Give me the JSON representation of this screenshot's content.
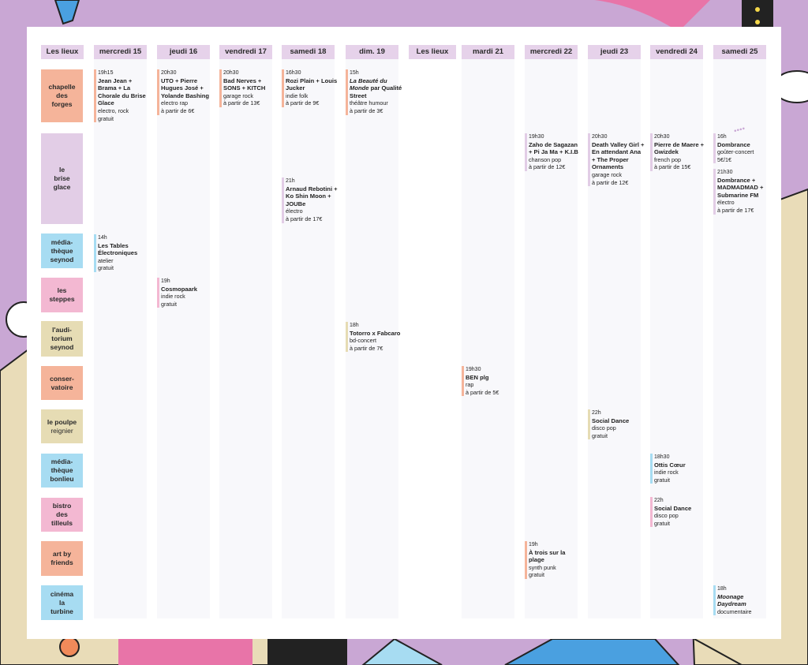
{
  "colors": {
    "salmon": "#f5b49a",
    "lilac": "#e2cde6",
    "blue": "#a7dcf2",
    "pink": "#f3b8d2",
    "khaki": "#e6dcb4",
    "header": "#e6d2ea"
  },
  "headers": [
    "Les lieux",
    "mercredi 15",
    "jeudi 16",
    "vendredi 17",
    "samedi 18",
    "dim. 19",
    "Les lieux",
    "mardi 21",
    "mercredi 22",
    "jeudi 23",
    "vendredi 24",
    "samedi 25"
  ],
  "venues": [
    {
      "lines": [
        "chapelle",
        "des",
        "forges"
      ],
      "color": "salmon"
    },
    {
      "lines": [
        "le",
        "brise",
        "glace"
      ],
      "color": "lilac"
    },
    {
      "lines": [
        "média-",
        "thèque",
        "seynod"
      ],
      "color": "blue"
    },
    {
      "lines": [
        "les",
        "steppes"
      ],
      "color": "pink"
    },
    {
      "lines": [
        "l'audi-",
        "torium",
        "seynod"
      ],
      "color": "khaki"
    },
    {
      "lines": [
        "conser-",
        "vatoire"
      ],
      "color": "salmon"
    },
    {
      "lines": [
        "le poulpe",
        "reignier"
      ],
      "color": "khaki"
    },
    {
      "lines": [
        "média-",
        "thèque",
        "bonlieu"
      ],
      "color": "blue"
    },
    {
      "lines": [
        "bistro",
        "des",
        "tilleuls"
      ],
      "color": "pink"
    },
    {
      "lines": [
        "art by",
        "friends"
      ],
      "color": "salmon"
    },
    {
      "lines": [
        "cinéma",
        "la",
        "turbine"
      ],
      "color": "blue"
    }
  ],
  "events": [
    {
      "time": "19h15",
      "title": "Jean Jean + Brama + La Chorale du Brise Glace",
      "genre": [
        "electro, rock",
        "gratuit"
      ],
      "color": "salmon"
    },
    {
      "time": "20h30",
      "title": "UTO + Pierre Hugues José + Yolande Bashing",
      "genre": [
        "electro rap",
        "à partir de 6€"
      ],
      "color": "salmon"
    },
    {
      "time": "20h30",
      "title": "Bad Nerves + SONS + KITCH",
      "genre": [
        "garage rock",
        "à partir de 13€"
      ],
      "color": "salmon"
    },
    {
      "time": "16h30",
      "title": "Rozi Plain + Louis Jucker",
      "genre": [
        "indie folk",
        "à partir de 9€"
      ],
      "color": "salmon"
    },
    {
      "time": "15h",
      "title_em": "La Beauté du Monde",
      "title": " par Qualité Street",
      "genre": [
        "théâtre humour",
        "à partir de 3€"
      ],
      "color": "salmon"
    },
    {
      "time": "19h30",
      "title": "Zaho de Sagazan + Pi Ja Ma + K.I.B",
      "genre": [
        "chanson pop",
        "à partir de 12€"
      ],
      "color": "lilac"
    },
    {
      "time": "20h30",
      "title": "Death Valley Girl + En attendant Ana + The Proper Ornaments",
      "genre": [
        "garage rock",
        "à partir de 12€"
      ],
      "color": "lilac"
    },
    {
      "time": "20h30",
      "title": "Pierre de Maere + Gwizdek",
      "genre": [
        "french pop",
        "à partir de 15€"
      ],
      "color": "lilac"
    },
    {
      "time": "16h",
      "title": "Dombrance",
      "genre": [
        "goûter-concert",
        "5€/1€"
      ],
      "color": "lilac"
    },
    {
      "time": "21h30",
      "title": "Dombrance + MADMADMAD + Submarine FM",
      "genre": [
        "électro",
        "à partir de 17€"
      ],
      "color": "lilac"
    },
    {
      "time": "21h",
      "title": "Arnaud Rebotini + Ko Shin Moon + JOUBe",
      "genre": [
        "électro",
        "à partir de 17€"
      ],
      "color": "lilac"
    },
    {
      "time": "14h",
      "title": "Les Tables Électroniques",
      "genre": [
        "atelier",
        "gratuit"
      ],
      "color": "blue"
    },
    {
      "time": "19h",
      "title": "Cosmopaark",
      "genre": [
        "indie rock",
        "gratuit"
      ],
      "color": "pink"
    },
    {
      "time": "18h",
      "title": "Totorro x Fabcaro",
      "genre": [
        "bd-concert",
        "à partir de 7€"
      ],
      "color": "khaki"
    },
    {
      "time": "19h30",
      "title": "BEN plg",
      "genre": [
        "rap",
        "à partir de 5€"
      ],
      "color": "salmon"
    },
    {
      "time": "22h",
      "title": "Social Dance",
      "genre": [
        "disco pop",
        "gratuit"
      ],
      "color": "khaki"
    },
    {
      "time": "18h30",
      "title": "Ottis Cœur",
      "genre": [
        "indie rock",
        "gratuit"
      ],
      "color": "blue"
    },
    {
      "time": "22h",
      "title": "Social Dance",
      "genre": [
        "disco pop",
        "gratuit"
      ],
      "color": "pink"
    },
    {
      "time": "19h",
      "title": "À trois sur la plage",
      "genre": [
        "synth punk",
        "gratuit"
      ],
      "color": "salmon"
    },
    {
      "time": "18h",
      "title_em": "Moonage Daydream",
      "title": "",
      "genre": [
        "documentaire"
      ],
      "color": "blue"
    }
  ]
}
